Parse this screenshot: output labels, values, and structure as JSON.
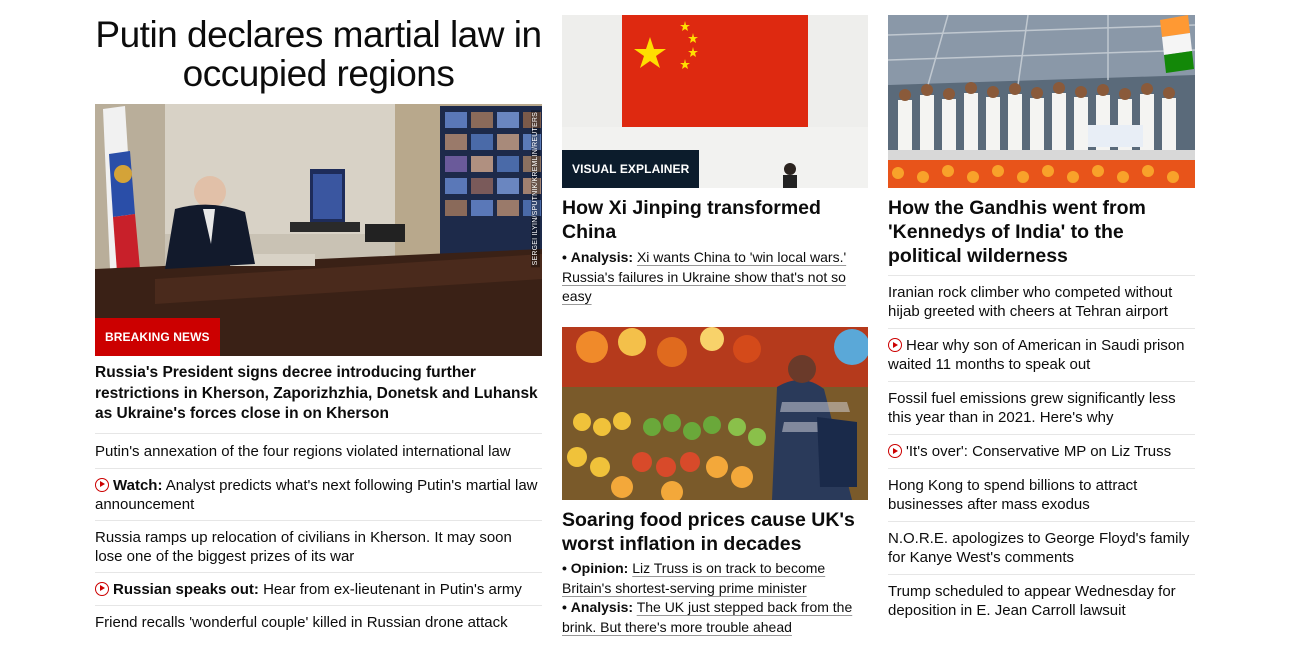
{
  "lead": {
    "headline": "Putin declares martial law in occupied regions",
    "image_credit": "SERGEI ILYIN/SPUTNIK/KREMLIN/REUTERS",
    "badge": "BREAKING NEWS",
    "title": "Russia's President signs decree introducing further restrictions in Kherson, Zaporizhzhia, Donetsk and Luhansk as Ukraine's forces close in on Kherson",
    "links": [
      {
        "prefix": "",
        "text": "Putin's annexation of the four regions violated international law",
        "video": false
      },
      {
        "prefix": "Watch:",
        "text": "Analyst predicts what's next following Putin's martial law announcement",
        "video": true
      },
      {
        "prefix": "",
        "text": "Russia ramps up relocation of civilians in Kherson. It may soon lose one of the biggest prizes of its war",
        "video": false
      },
      {
        "prefix": "Russian speaks out:",
        "text": "Hear from ex-lieutenant in Putin's army",
        "video": true
      },
      {
        "prefix": "",
        "text": "Friend recalls 'wonderful couple' killed in Russian drone attack",
        "video": false
      }
    ]
  },
  "xi_story": {
    "badge": "VISUAL EXPLAINER",
    "title": "How Xi Jinping transformed China",
    "sub_prefix": "Analysis:",
    "sub_text": "Xi wants China to 'win local wars.' Russia's failures in Ukraine show that's not so easy"
  },
  "food_story": {
    "title": "Soaring food prices cause UK's worst inflation in decades",
    "subs": [
      {
        "prefix": "Opinion:",
        "text": "Liz Truss is on track to become Britain's shortest-serving prime minister"
      },
      {
        "prefix": "Analysis:",
        "text": "The UK just stepped back from the brink. But there's more trouble ahead"
      }
    ]
  },
  "gandhi_story": {
    "title": "How the Gandhis went from 'Kennedys of India' to the political wilderness",
    "links": [
      {
        "text": "Iranian rock climber who competed without hijab greeted with cheers at Tehran airport",
        "video": false
      },
      {
        "text": "Hear why son of American in Saudi prison waited 11 months to speak out",
        "video": true
      },
      {
        "text": "Fossil fuel emissions grew significantly less this year than in 2021. Here's why",
        "video": false
      },
      {
        "text": "'It's over': Conservative MP on Liz Truss",
        "video": true
      },
      {
        "text": "Hong Kong to spend billions to attract businesses after mass exodus",
        "video": false
      },
      {
        "text": "N.O.R.E. apologizes to George Floyd's family for Kanye West's comments",
        "video": false
      },
      {
        "text": "Trump scheduled to appear Wednesday for deposition in E. Jean Carroll lawsuit",
        "video": false
      }
    ]
  },
  "colors": {
    "breaking_red": "#cc0000",
    "explainer_navy": "#0c1c2c",
    "text": "#0c0c0c",
    "divider": "#e6e6e6"
  }
}
